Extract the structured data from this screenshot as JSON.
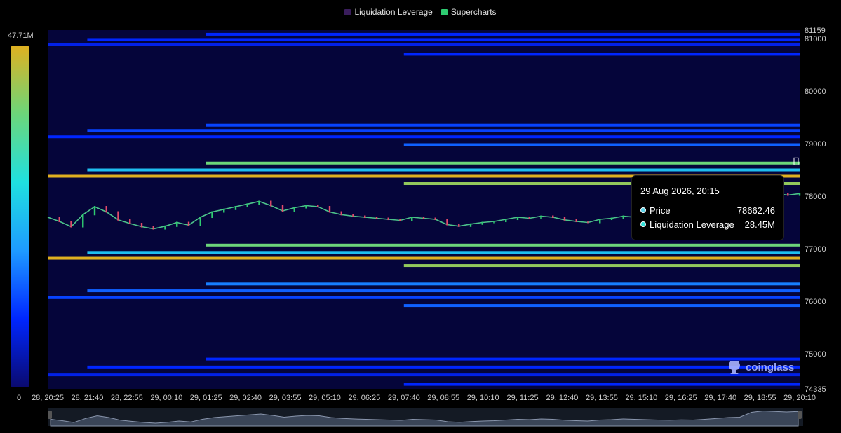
{
  "legend": {
    "items": [
      {
        "label": "Liquidation Leverage",
        "color": "#3a1d5c"
      },
      {
        "label": "Supercharts",
        "color": "#2ecc71"
      }
    ]
  },
  "colorbar": {
    "max_label": "47.71M",
    "min_label": "0",
    "colors": [
      "#0a0a6e",
      "#0026ff",
      "#1e9bff",
      "#1fe0e0",
      "#6cd67a",
      "#e0b020"
    ]
  },
  "tooltip": {
    "title": "29 Aug 2026, 20:15",
    "rows": [
      {
        "label": "Price",
        "value": "78662.46",
        "dot_color": "#5ad1e6"
      },
      {
        "label": "Liquidation Leverage",
        "value": "28.45M",
        "dot_color": "#31e0d8"
      }
    ]
  },
  "logo": {
    "text": "coinglass",
    "icon": "coinglass-logo-icon"
  },
  "chart_data": {
    "type": "heatmap",
    "x_ticks": [
      "28, 20:25",
      "28, 21:40",
      "28, 22:55",
      "29, 00:10",
      "29, 01:25",
      "29, 02:40",
      "29, 03:55",
      "29, 05:10",
      "29, 06:25",
      "29, 07:40",
      "29, 08:55",
      "29, 10:10",
      "29, 11:25",
      "29, 12:40",
      "29, 13:55",
      "29, 15:10",
      "29, 16:25",
      "29, 17:40",
      "29, 18:55",
      "29, 20:10"
    ],
    "y_ticks": [
      81159,
      81000,
      80000,
      79000,
      78000,
      77000,
      76000,
      75000,
      74335
    ],
    "ylim": [
      74335,
      81159
    ],
    "y_axis_position": "right",
    "colorbar_range": [
      0,
      47.71
    ],
    "colorbar_unit": "M",
    "liquidation_bands": [
      {
        "price": 81080,
        "start": "29, 01:25",
        "intensity": 0.3
      },
      {
        "price": 80980,
        "start": "28, 21:40",
        "intensity": 0.3
      },
      {
        "price": 80880,
        "start": "28, 20:25",
        "intensity": 0.25
      },
      {
        "price": 80700,
        "start": "29, 07:40",
        "intensity": 0.3
      },
      {
        "price": 79350,
        "start": "29, 01:25",
        "intensity": 0.35
      },
      {
        "price": 79250,
        "start": "28, 21:40",
        "intensity": 0.35
      },
      {
        "price": 79130,
        "start": "28, 20:25",
        "intensity": 0.3
      },
      {
        "price": 78980,
        "start": "29, 07:40",
        "intensity": 0.4
      },
      {
        "price": 78630,
        "start": "29, 01:25",
        "intensity": 0.85
      },
      {
        "price": 78500,
        "start": "28, 21:40",
        "intensity": 0.6
      },
      {
        "price": 78380,
        "start": "28, 20:25",
        "intensity": 1.0
      },
      {
        "price": 78240,
        "start": "29, 07:40",
        "intensity": 0.9
      },
      {
        "price": 77070,
        "start": "29, 01:25",
        "intensity": 0.85
      },
      {
        "price": 76930,
        "start": "28, 21:40",
        "intensity": 0.6
      },
      {
        "price": 76820,
        "start": "28, 20:25",
        "intensity": 1.0
      },
      {
        "price": 76680,
        "start": "29, 07:40",
        "intensity": 0.9
      },
      {
        "price": 76330,
        "start": "29, 01:25",
        "intensity": 0.45
      },
      {
        "price": 76200,
        "start": "28, 21:40",
        "intensity": 0.4
      },
      {
        "price": 76070,
        "start": "28, 20:25",
        "intensity": 0.35
      },
      {
        "price": 75920,
        "start": "29, 07:40",
        "intensity": 0.4
      },
      {
        "price": 74900,
        "start": "29, 01:25",
        "intensity": 0.3
      },
      {
        "price": 74750,
        "start": "28, 21:40",
        "intensity": 0.3
      },
      {
        "price": 74600,
        "start": "28, 20:25",
        "intensity": 0.25
      },
      {
        "price": 74420,
        "start": "29, 07:40",
        "intensity": 0.3
      }
    ],
    "price_series": [
      77600,
      77520,
      77420,
      77650,
      77800,
      77700,
      77550,
      77480,
      77420,
      77380,
      77430,
      77500,
      77450,
      77600,
      77700,
      77750,
      77800,
      77850,
      77900,
      77820,
      77720,
      77780,
      77820,
      77800,
      77700,
      77650,
      77620,
      77600,
      77580,
      77560,
      77540,
      77600,
      77580,
      77560,
      77460,
      77430,
      77470,
      77500,
      77520,
      77560,
      77600,
      77580,
      77620,
      77600,
      77550,
      77520,
      77500,
      77560,
      77580,
      77620,
      77600,
      77580,
      77560,
      77550,
      77570,
      77560,
      77600,
      77650,
      77700,
      77720,
      78000,
      78080,
      78050,
      78020,
      78050
    ]
  }
}
